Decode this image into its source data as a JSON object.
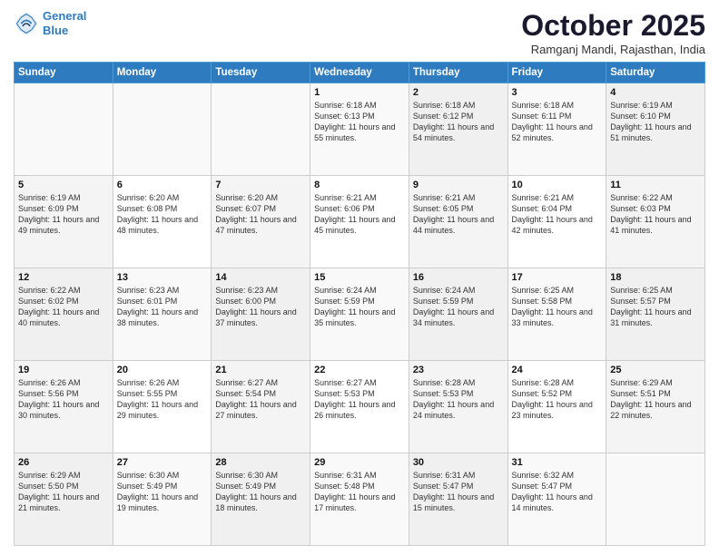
{
  "header": {
    "logo_line1": "General",
    "logo_line2": "Blue",
    "month": "October 2025",
    "location": "Ramganj Mandi, Rajasthan, India"
  },
  "days_of_week": [
    "Sunday",
    "Monday",
    "Tuesday",
    "Wednesday",
    "Thursday",
    "Friday",
    "Saturday"
  ],
  "weeks": [
    [
      {
        "day": "",
        "sunrise": "",
        "sunset": "",
        "daylight": ""
      },
      {
        "day": "",
        "sunrise": "",
        "sunset": "",
        "daylight": ""
      },
      {
        "day": "",
        "sunrise": "",
        "sunset": "",
        "daylight": ""
      },
      {
        "day": "1",
        "sunrise": "Sunrise: 6:18 AM",
        "sunset": "Sunset: 6:13 PM",
        "daylight": "Daylight: 11 hours and 55 minutes."
      },
      {
        "day": "2",
        "sunrise": "Sunrise: 6:18 AM",
        "sunset": "Sunset: 6:12 PM",
        "daylight": "Daylight: 11 hours and 54 minutes."
      },
      {
        "day": "3",
        "sunrise": "Sunrise: 6:18 AM",
        "sunset": "Sunset: 6:11 PM",
        "daylight": "Daylight: 11 hours and 52 minutes."
      },
      {
        "day": "4",
        "sunrise": "Sunrise: 6:19 AM",
        "sunset": "Sunset: 6:10 PM",
        "daylight": "Daylight: 11 hours and 51 minutes."
      }
    ],
    [
      {
        "day": "5",
        "sunrise": "Sunrise: 6:19 AM",
        "sunset": "Sunset: 6:09 PM",
        "daylight": "Daylight: 11 hours and 49 minutes."
      },
      {
        "day": "6",
        "sunrise": "Sunrise: 6:20 AM",
        "sunset": "Sunset: 6:08 PM",
        "daylight": "Daylight: 11 hours and 48 minutes."
      },
      {
        "day": "7",
        "sunrise": "Sunrise: 6:20 AM",
        "sunset": "Sunset: 6:07 PM",
        "daylight": "Daylight: 11 hours and 47 minutes."
      },
      {
        "day": "8",
        "sunrise": "Sunrise: 6:21 AM",
        "sunset": "Sunset: 6:06 PM",
        "daylight": "Daylight: 11 hours and 45 minutes."
      },
      {
        "day": "9",
        "sunrise": "Sunrise: 6:21 AM",
        "sunset": "Sunset: 6:05 PM",
        "daylight": "Daylight: 11 hours and 44 minutes."
      },
      {
        "day": "10",
        "sunrise": "Sunrise: 6:21 AM",
        "sunset": "Sunset: 6:04 PM",
        "daylight": "Daylight: 11 hours and 42 minutes."
      },
      {
        "day": "11",
        "sunrise": "Sunrise: 6:22 AM",
        "sunset": "Sunset: 6:03 PM",
        "daylight": "Daylight: 11 hours and 41 minutes."
      }
    ],
    [
      {
        "day": "12",
        "sunrise": "Sunrise: 6:22 AM",
        "sunset": "Sunset: 6:02 PM",
        "daylight": "Daylight: 11 hours and 40 minutes."
      },
      {
        "day": "13",
        "sunrise": "Sunrise: 6:23 AM",
        "sunset": "Sunset: 6:01 PM",
        "daylight": "Daylight: 11 hours and 38 minutes."
      },
      {
        "day": "14",
        "sunrise": "Sunrise: 6:23 AM",
        "sunset": "Sunset: 6:00 PM",
        "daylight": "Daylight: 11 hours and 37 minutes."
      },
      {
        "day": "15",
        "sunrise": "Sunrise: 6:24 AM",
        "sunset": "Sunset: 5:59 PM",
        "daylight": "Daylight: 11 hours and 35 minutes."
      },
      {
        "day": "16",
        "sunrise": "Sunrise: 6:24 AM",
        "sunset": "Sunset: 5:59 PM",
        "daylight": "Daylight: 11 hours and 34 minutes."
      },
      {
        "day": "17",
        "sunrise": "Sunrise: 6:25 AM",
        "sunset": "Sunset: 5:58 PM",
        "daylight": "Daylight: 11 hours and 33 minutes."
      },
      {
        "day": "18",
        "sunrise": "Sunrise: 6:25 AM",
        "sunset": "Sunset: 5:57 PM",
        "daylight": "Daylight: 11 hours and 31 minutes."
      }
    ],
    [
      {
        "day": "19",
        "sunrise": "Sunrise: 6:26 AM",
        "sunset": "Sunset: 5:56 PM",
        "daylight": "Daylight: 11 hours and 30 minutes."
      },
      {
        "day": "20",
        "sunrise": "Sunrise: 6:26 AM",
        "sunset": "Sunset: 5:55 PM",
        "daylight": "Daylight: 11 hours and 29 minutes."
      },
      {
        "day": "21",
        "sunrise": "Sunrise: 6:27 AM",
        "sunset": "Sunset: 5:54 PM",
        "daylight": "Daylight: 11 hours and 27 minutes."
      },
      {
        "day": "22",
        "sunrise": "Sunrise: 6:27 AM",
        "sunset": "Sunset: 5:53 PM",
        "daylight": "Daylight: 11 hours and 26 minutes."
      },
      {
        "day": "23",
        "sunrise": "Sunrise: 6:28 AM",
        "sunset": "Sunset: 5:53 PM",
        "daylight": "Daylight: 11 hours and 24 minutes."
      },
      {
        "day": "24",
        "sunrise": "Sunrise: 6:28 AM",
        "sunset": "Sunset: 5:52 PM",
        "daylight": "Daylight: 11 hours and 23 minutes."
      },
      {
        "day": "25",
        "sunrise": "Sunrise: 6:29 AM",
        "sunset": "Sunset: 5:51 PM",
        "daylight": "Daylight: 11 hours and 22 minutes."
      }
    ],
    [
      {
        "day": "26",
        "sunrise": "Sunrise: 6:29 AM",
        "sunset": "Sunset: 5:50 PM",
        "daylight": "Daylight: 11 hours and 21 minutes."
      },
      {
        "day": "27",
        "sunrise": "Sunrise: 6:30 AM",
        "sunset": "Sunset: 5:49 PM",
        "daylight": "Daylight: 11 hours and 19 minutes."
      },
      {
        "day": "28",
        "sunrise": "Sunrise: 6:30 AM",
        "sunset": "Sunset: 5:49 PM",
        "daylight": "Daylight: 11 hours and 18 minutes."
      },
      {
        "day": "29",
        "sunrise": "Sunrise: 6:31 AM",
        "sunset": "Sunset: 5:48 PM",
        "daylight": "Daylight: 11 hours and 17 minutes."
      },
      {
        "day": "30",
        "sunrise": "Sunrise: 6:31 AM",
        "sunset": "Sunset: 5:47 PM",
        "daylight": "Daylight: 11 hours and 15 minutes."
      },
      {
        "day": "31",
        "sunrise": "Sunrise: 6:32 AM",
        "sunset": "Sunset: 5:47 PM",
        "daylight": "Daylight: 11 hours and 14 minutes."
      },
      {
        "day": "",
        "sunrise": "",
        "sunset": "",
        "daylight": ""
      }
    ]
  ]
}
